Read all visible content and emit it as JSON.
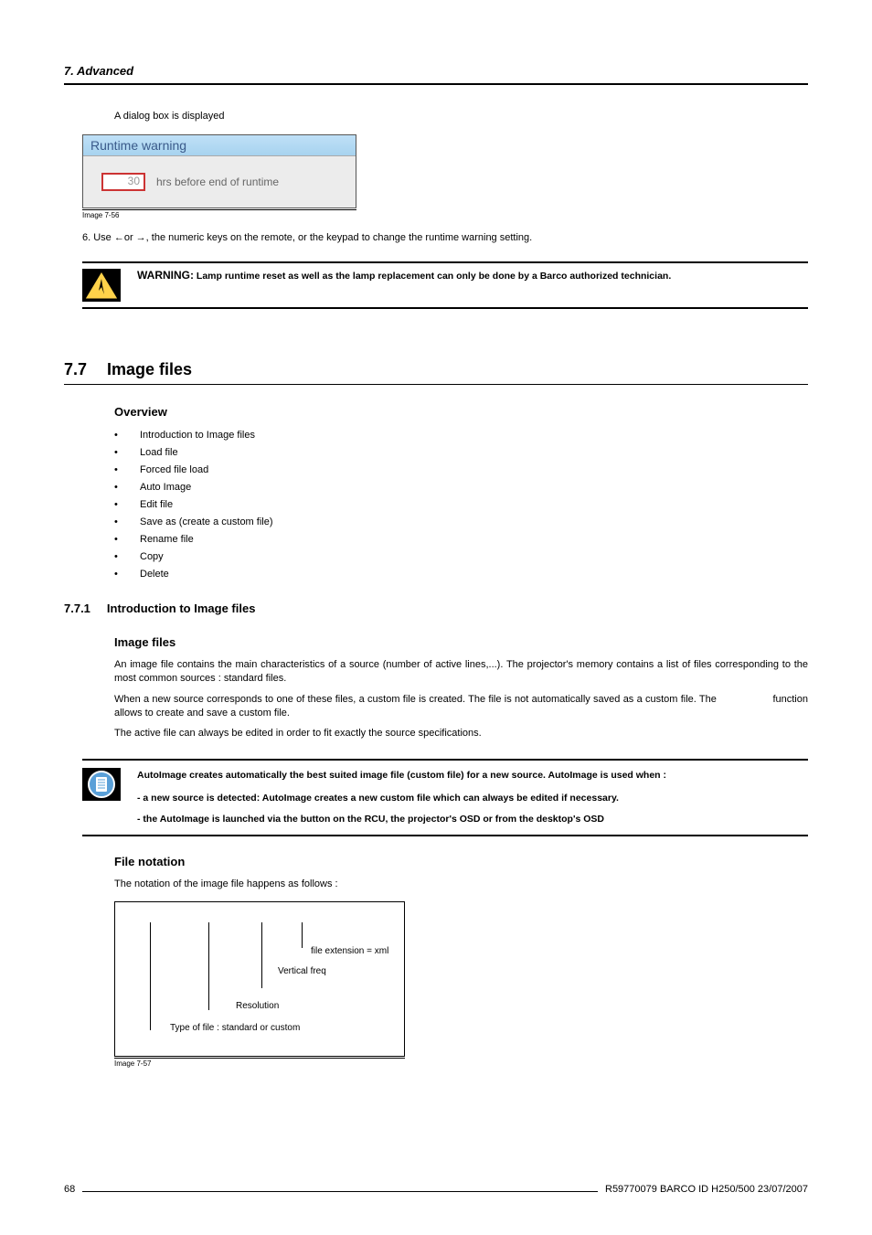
{
  "header": {
    "chapter": "7. Advanced"
  },
  "intro_text": "A dialog box is displayed",
  "dialog": {
    "title": "Runtime warning",
    "value": "30",
    "label": "hrs before end of runtime"
  },
  "caption1": "Image 7-56",
  "step6": "6.  Use ←or →, the numeric keys on the remote, or the keypad to change the runtime warning setting.",
  "warning": {
    "lead_word": "WARNING:",
    "text": " Lamp runtime reset as well as the lamp replacement can only be done by a Barco authorized technician."
  },
  "section": {
    "num": "7.7",
    "title": "Image files"
  },
  "overview": {
    "heading": "Overview",
    "items": [
      "Introduction to Image files",
      "Load file",
      "Forced file load",
      "Auto Image",
      "Edit file",
      "Save as (create a custom file)",
      "Rename file",
      "Copy",
      "Delete"
    ]
  },
  "subsection": {
    "num": "7.7.1",
    "title": "Introduction to Image files"
  },
  "imagefiles": {
    "heading": "Image files",
    "p1": "An image file contains the main characteristics of a source (number of active lines,...). The projector's memory contains a list of files corresponding to the most common sources : standard files.",
    "p2a": "When a new source corresponds to one of these files, a custom file is created. The file is not automatically saved as a custom file. The ",
    "p2b": " function allows to create and save a custom file.",
    "p3": "The active file can always be edited in order to fit exactly the source specifications."
  },
  "info": {
    "l1": "AutoImage creates automatically the best suited image file (custom file) for a new source. AutoImage is used when :",
    "l2": "- a new source is detected: AutoImage creates a new custom file which can always be edited if necessary.",
    "l3": "- the AutoImage is launched via the button on the RCU, the projector's OSD or from the desktop's OSD"
  },
  "filenotation": {
    "heading": "File notation",
    "p1": "The notation of the image file happens as follows :"
  },
  "diagram": {
    "ext": "file extension = xml",
    "vfreq": "Vertical freq",
    "res": "Resolution",
    "type": "Type of file : standard or custom"
  },
  "caption2": "Image 7-57",
  "footer": {
    "page": "68",
    "doc": "R59770079  BARCO ID H250/500  23/07/2007"
  }
}
